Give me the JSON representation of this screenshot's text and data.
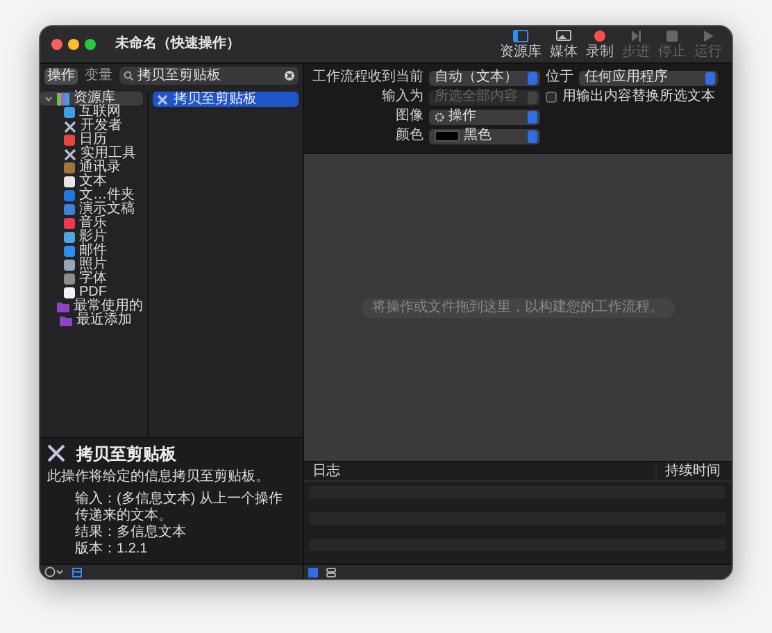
{
  "window": {
    "title": "未命名（快速操作）"
  },
  "toolbar": [
    {
      "label": "资源库",
      "kind": "library",
      "selected": true,
      "disabled": false
    },
    {
      "label": "媒体",
      "kind": "media",
      "selected": false,
      "disabled": false
    },
    {
      "label": "录制",
      "kind": "record",
      "selected": false,
      "disabled": false
    },
    {
      "label": "步进",
      "kind": "step",
      "selected": false,
      "disabled": true
    },
    {
      "label": "停止",
      "kind": "stop",
      "selected": false,
      "disabled": true
    },
    {
      "label": "运行",
      "kind": "run",
      "selected": false,
      "disabled": true
    }
  ],
  "segments": [
    {
      "label": "操作",
      "selected": true
    },
    {
      "label": "变量",
      "selected": false
    }
  ],
  "search": {
    "value": "拷贝至剪贴板"
  },
  "sidebar": {
    "items": [
      {
        "label": "资源库",
        "kind": "library",
        "expanded": true,
        "selected": true,
        "children": [
          {
            "label": "互联网",
            "kind": "tile",
            "color": "#3aa0e8"
          },
          {
            "label": "开发者",
            "kind": "tools"
          },
          {
            "label": "日历",
            "kind": "tile",
            "color": "#e8453c"
          },
          {
            "label": "实用工具",
            "kind": "tools"
          },
          {
            "label": "通讯录",
            "kind": "tile",
            "color": "#a0753a"
          },
          {
            "label": "文本",
            "kind": "tile",
            "color": "#e6e6e6"
          },
          {
            "label": "文…件夹",
            "kind": "tile",
            "color": "#1f7ae0"
          },
          {
            "label": "演示文稿",
            "kind": "tile",
            "color": "#3b82d6"
          },
          {
            "label": "音乐",
            "kind": "tile",
            "color": "#f0384e"
          },
          {
            "label": "影片",
            "kind": "tile",
            "color": "#4aa8e0"
          },
          {
            "label": "邮件",
            "kind": "tile",
            "color": "#2f8ef0"
          },
          {
            "label": "照片",
            "kind": "tile",
            "color": "#9aa6b8"
          },
          {
            "label": "字体",
            "kind": "tile",
            "color": "#8c8c8c"
          },
          {
            "label": "PDF",
            "kind": "tile",
            "color": "#f2f2f2"
          }
        ]
      },
      {
        "label": "最常使用的",
        "kind": "folder",
        "selected": false
      },
      {
        "label": "最近添加",
        "kind": "folder",
        "selected": false
      }
    ]
  },
  "actions": [
    {
      "label": "拷贝至剪贴板",
      "selected": true
    }
  ],
  "description": {
    "title": "拷贝至剪贴板",
    "summary": "此操作将给定的信息拷贝至剪贴板。",
    "details": [
      "输入：(多信息文本) 从上一个操作传递来的文本。",
      "结果：多信息文本",
      "版本：1.2.1"
    ]
  },
  "settings": [
    {
      "label": "工作流程收到当前",
      "control": {
        "kind": "popup",
        "value": "自动（文本）",
        "disabled": false
      },
      "extra_label": "位于",
      "extra": {
        "kind": "popup",
        "value": "任何应用程序",
        "disabled": false
      }
    },
    {
      "label": "输入为",
      "control": {
        "kind": "popup",
        "value": "所选全部内容",
        "disabled": true
      },
      "extra": {
        "kind": "checkbox",
        "value": "用输出内容替换所选文本",
        "checked": false
      }
    },
    {
      "label": "图像",
      "control": {
        "kind": "action_popup",
        "value": "操作",
        "disabled": false
      }
    },
    {
      "label": "颜色",
      "control": {
        "kind": "color_popup",
        "value": "黑色",
        "color": "#000000",
        "disabled": false
      }
    }
  ],
  "canvas": {
    "placeholder": "将操作或文件拖到这里，以构建您的工作流程。"
  },
  "log": {
    "columns": [
      "日志",
      "持续时间"
    ]
  }
}
